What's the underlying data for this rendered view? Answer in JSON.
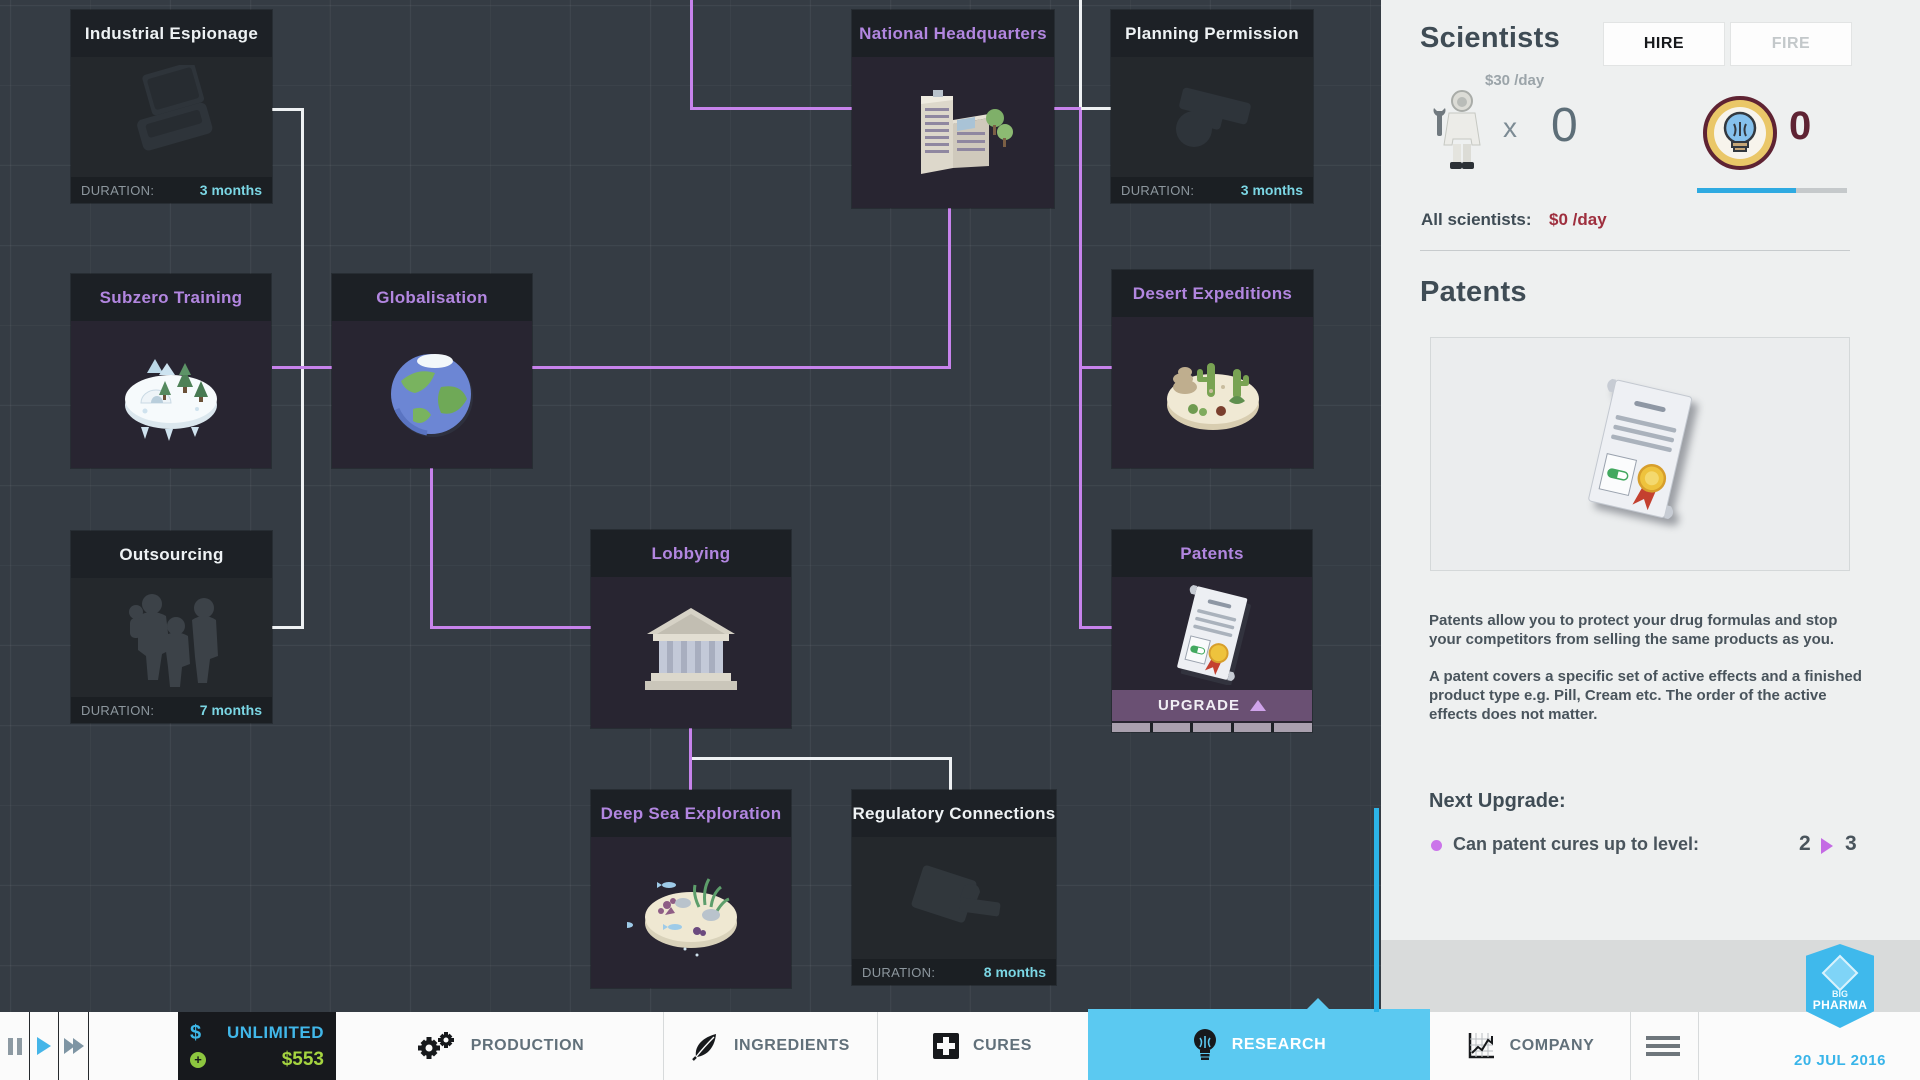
{
  "research_tree": {
    "nodes": {
      "industrial_espionage": {
        "title": "Industrial Espionage",
        "status": "available",
        "duration_label": "DURATION:",
        "duration": "3 months",
        "icon": "laptop-icon"
      },
      "national_headquarters": {
        "title": "National Headquarters",
        "status": "researched",
        "icon": "buildings-icon"
      },
      "planning_permission": {
        "title": "Planning Permission",
        "status": "available",
        "duration_label": "DURATION:",
        "duration": "3 months",
        "icon": "blueprint-icon"
      },
      "subzero_training": {
        "title": "Subzero Training",
        "status": "researched",
        "icon": "arctic-island-icon"
      },
      "globalisation": {
        "title": "Globalisation",
        "status": "researched",
        "icon": "globe-icon"
      },
      "desert_expeditions": {
        "title": "Desert Expeditions",
        "status": "researched",
        "icon": "desert-island-icon"
      },
      "outsourcing": {
        "title": "Outsourcing",
        "status": "available",
        "duration_label": "DURATION:",
        "duration": "7 months",
        "icon": "workers-icon"
      },
      "lobbying": {
        "title": "Lobbying",
        "status": "researched",
        "icon": "government-building-icon"
      },
      "patents": {
        "title": "Patents",
        "status": "upgradeable",
        "upgrade_label": "UPGRADE",
        "icon": "patent-document-icon"
      },
      "deep_sea_exploration": {
        "title": "Deep Sea Exploration",
        "status": "researched",
        "icon": "seabed-island-icon"
      },
      "regulatory_connections": {
        "title": "Regulatory Connections",
        "status": "available",
        "duration_label": "DURATION:",
        "duration": "8 months",
        "icon": "rubber-stamp-icon"
      }
    }
  },
  "sidebar": {
    "scientists": {
      "title": "Scientists",
      "hire_label": "HIRE",
      "fire_label": "FIRE",
      "rate_per_scientist": "$30 /day",
      "multiply_symbol": "x",
      "count": "0",
      "research_level": "0",
      "all_scientists_label": "All scientists:",
      "all_scientists_rate": "$0 /day"
    },
    "patents": {
      "title": "Patents",
      "paragraph1": "Patents allow you to protect your drug formulas and stop your competitors from selling the same products as you.",
      "paragraph2": "A patent covers a specific set of active effects and a finished product type e.g. Pill, Cream etc. The order of the active effects does not matter.",
      "next_upgrade_label": "Next Upgrade:",
      "upgrade_effect": "Can patent cures up to level:",
      "level_current": "2",
      "level_next": "3"
    }
  },
  "bottom_bar": {
    "money": {
      "currency_symbol": "$",
      "daily_budget": "UNLIMITED",
      "cash": "$553",
      "plus_symbol": "+"
    },
    "tabs": {
      "production": "PRODUCTION",
      "ingredients": "INGREDIENTS",
      "cures": "CURES",
      "research": "RESEARCH",
      "company": "COMPANY"
    },
    "date": "20 JUL 2016",
    "logo": {
      "line1": "BIG",
      "line2": "PHARMA"
    }
  },
  "colors": {
    "accent_blue": "#5bc9f1",
    "accent_purple": "#c783ec",
    "node_title_researched": "#b286e0",
    "duration_cyan": "#7bd6e4",
    "cash_green": "#a5d440",
    "alert_red": "#9e2f3e"
  }
}
